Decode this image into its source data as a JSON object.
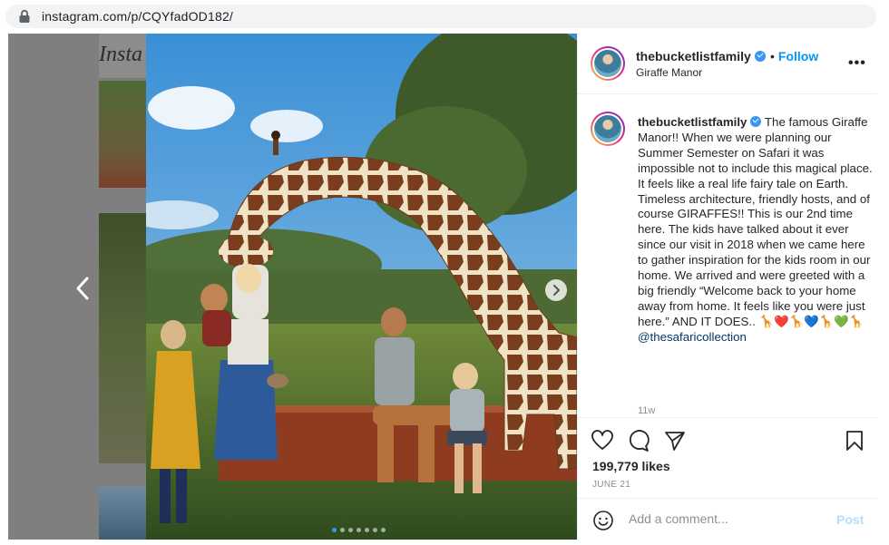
{
  "browser": {
    "url": "instagram.com/p/CQYfadOD182/"
  },
  "background_page": {
    "logo_text": "Insta"
  },
  "post": {
    "username": "thebucketlistfamily",
    "follow_label": "Follow",
    "follow_separator": "•",
    "location": "Giraffe Manor",
    "more_label": "•••",
    "caption_username": "thebucketlistfamily",
    "caption_text": "The famous Giraffe Manor!! When we were planning our Summer Semester on Safari it was impossible not to include this magical place. It feels like a real life fairy tale on Earth. Timeless architecture, friendly hosts, and of course GIRAFFES!! This is our 2nd time here. The kids have talked about it ever since our visit in 2018 when we came here to gather inspiration for the kids room in our home. We arrived and were greeted with a big friendly “Welcome back to your home away from home. It feels like you were just here.” AND IT DOES.. 🦒❤️🦒💙🦒💚🦒",
    "mention": "@thesafaricollection",
    "time_ago": "11w",
    "likes": "199,779 likes",
    "date": "JUNE 21",
    "comment_placeholder": "Add a comment...",
    "post_label": "Post",
    "carousel": {
      "count": 7,
      "active_index": 0
    }
  },
  "colors": {
    "link_blue": "#0095f6",
    "verified_blue": "#3897f0",
    "post_disabled": "#b2dffc",
    "muted_text": "#8e8e8e"
  },
  "icons": [
    "lock-icon",
    "verified-icon",
    "more-icon",
    "prev-arrow-icon",
    "next-arrow-icon",
    "heart-icon",
    "comment-icon",
    "share-icon",
    "bookmark-icon",
    "emoji-icon"
  ]
}
